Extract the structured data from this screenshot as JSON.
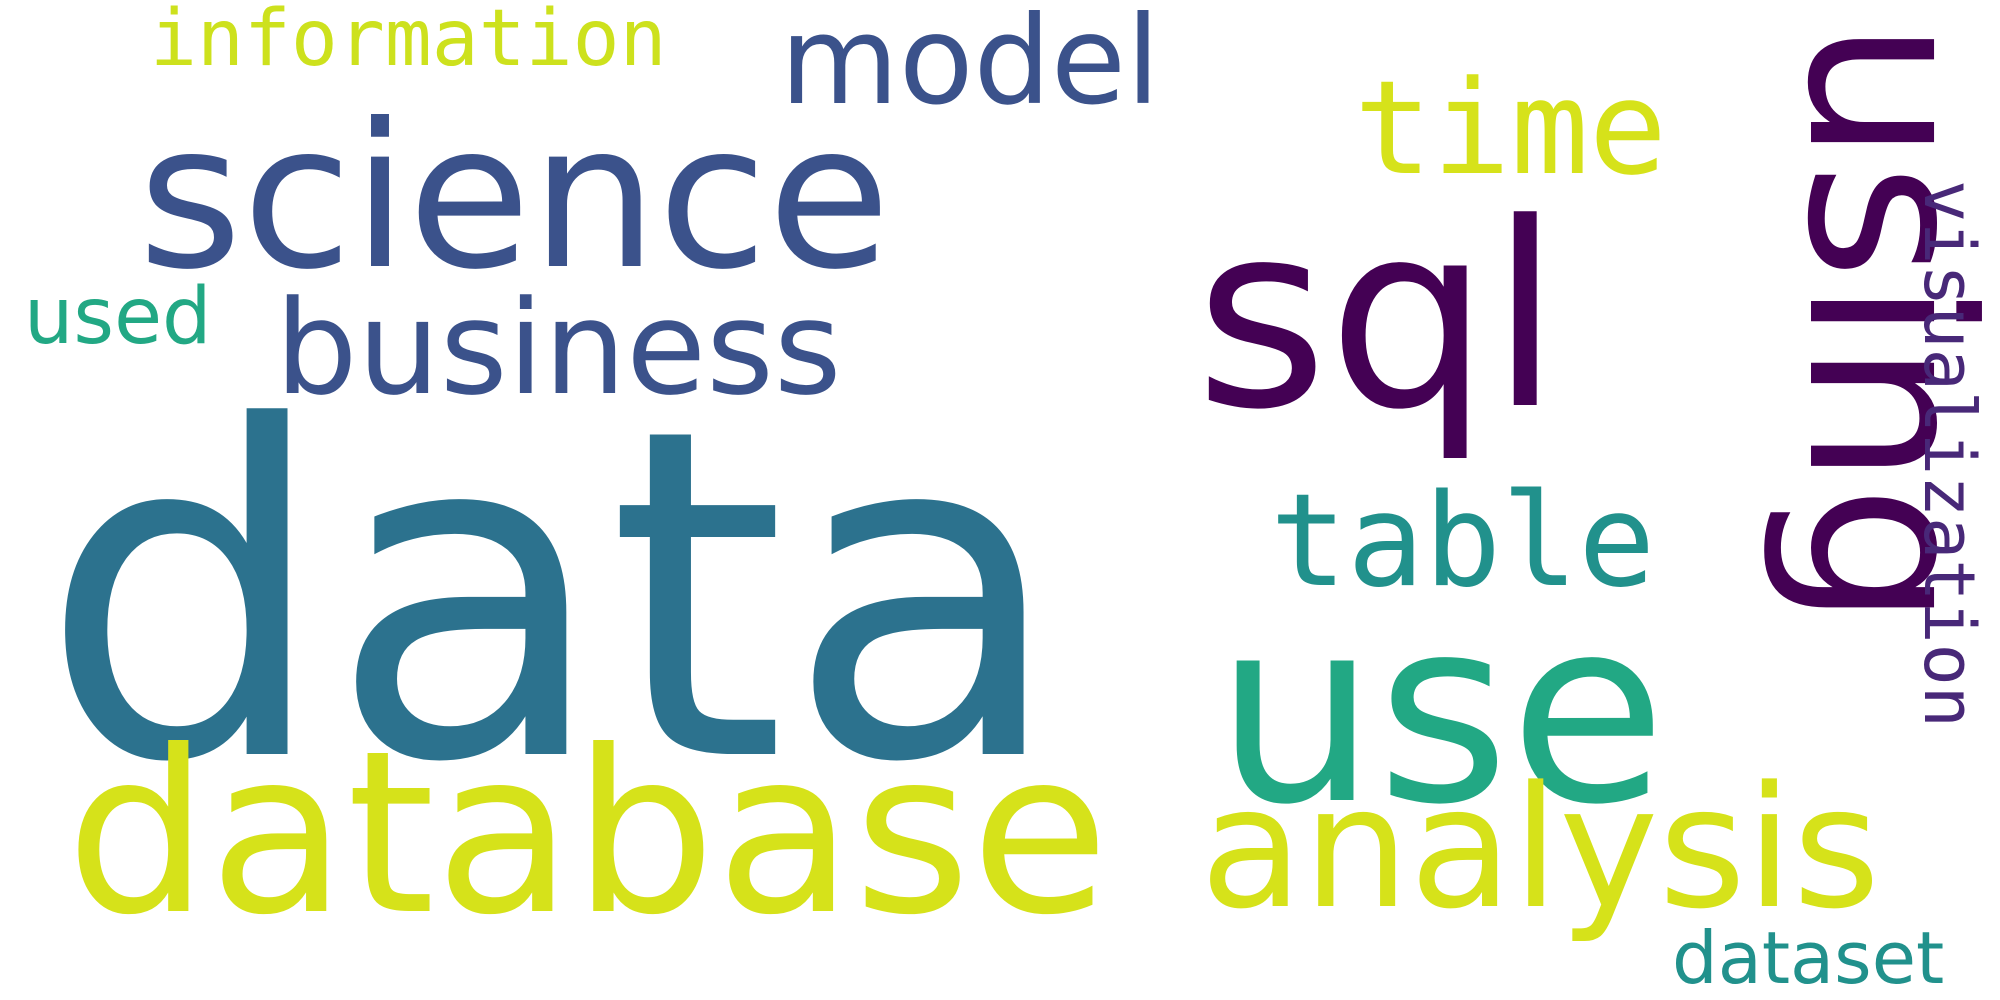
{
  "words": {
    "data": {
      "text": "data",
      "color": "#2c728e"
    },
    "sql": {
      "text": "sql",
      "color": "#440154"
    },
    "using": {
      "text": "using",
      "color": "#440154"
    },
    "science": {
      "text": "science",
      "color": "#3b528b"
    },
    "use": {
      "text": "use",
      "color": "#22a884"
    },
    "database": {
      "text": "database",
      "color": "#d6e21a"
    },
    "analysis": {
      "text": "analysis",
      "color": "#d6e21a"
    },
    "business": {
      "text": "business",
      "color": "#3b528b"
    },
    "table": {
      "text": "table",
      "color": "#21918c"
    },
    "time": {
      "text": "time",
      "color": "#d6e21a"
    },
    "model": {
      "text": "model",
      "color": "#3b528b"
    },
    "information": {
      "text": "information",
      "color": "#cde11d"
    },
    "visualization": {
      "text": "visualization",
      "color": "#482878"
    },
    "dataset": {
      "text": "dataset",
      "color": "#21918c"
    },
    "used": {
      "text": "used",
      "color": "#22a884"
    }
  }
}
